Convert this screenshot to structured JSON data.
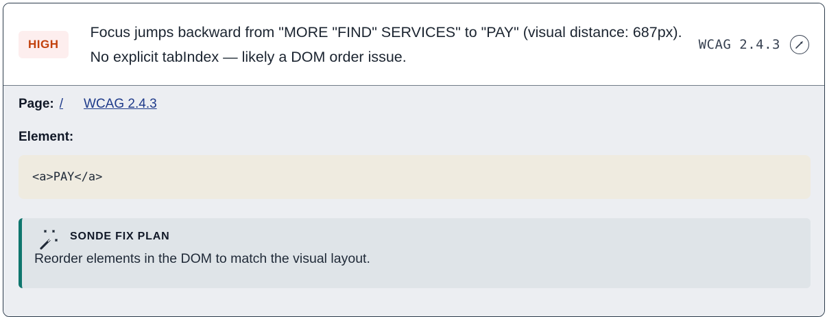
{
  "issue": {
    "severity": "HIGH",
    "message": "Focus jumps backward from \"MORE \"FIND\" SERVICES\" to \"PAY\" (visual distance: 687px). No explicit tabIndex — likely a DOM order issue.",
    "wcag_code": "WCAG 2.4.3",
    "icon": "compass-icon"
  },
  "details": {
    "page_label": "Page:",
    "page_link": "/",
    "wcag_link": "WCAG 2.4.3",
    "element_label": "Element:",
    "element_code": "<a>PAY</a>"
  },
  "fix_plan": {
    "icon": "magic-wand-icon",
    "title": "SONDE FIX PLAN",
    "description": "Reorder elements in the DOM to match the visual layout."
  },
  "colors": {
    "severity_text": "#c2410c",
    "severity_bg": "#fdeeee",
    "fix_accent": "#0f766e",
    "code_bg": "#efebe0"
  }
}
